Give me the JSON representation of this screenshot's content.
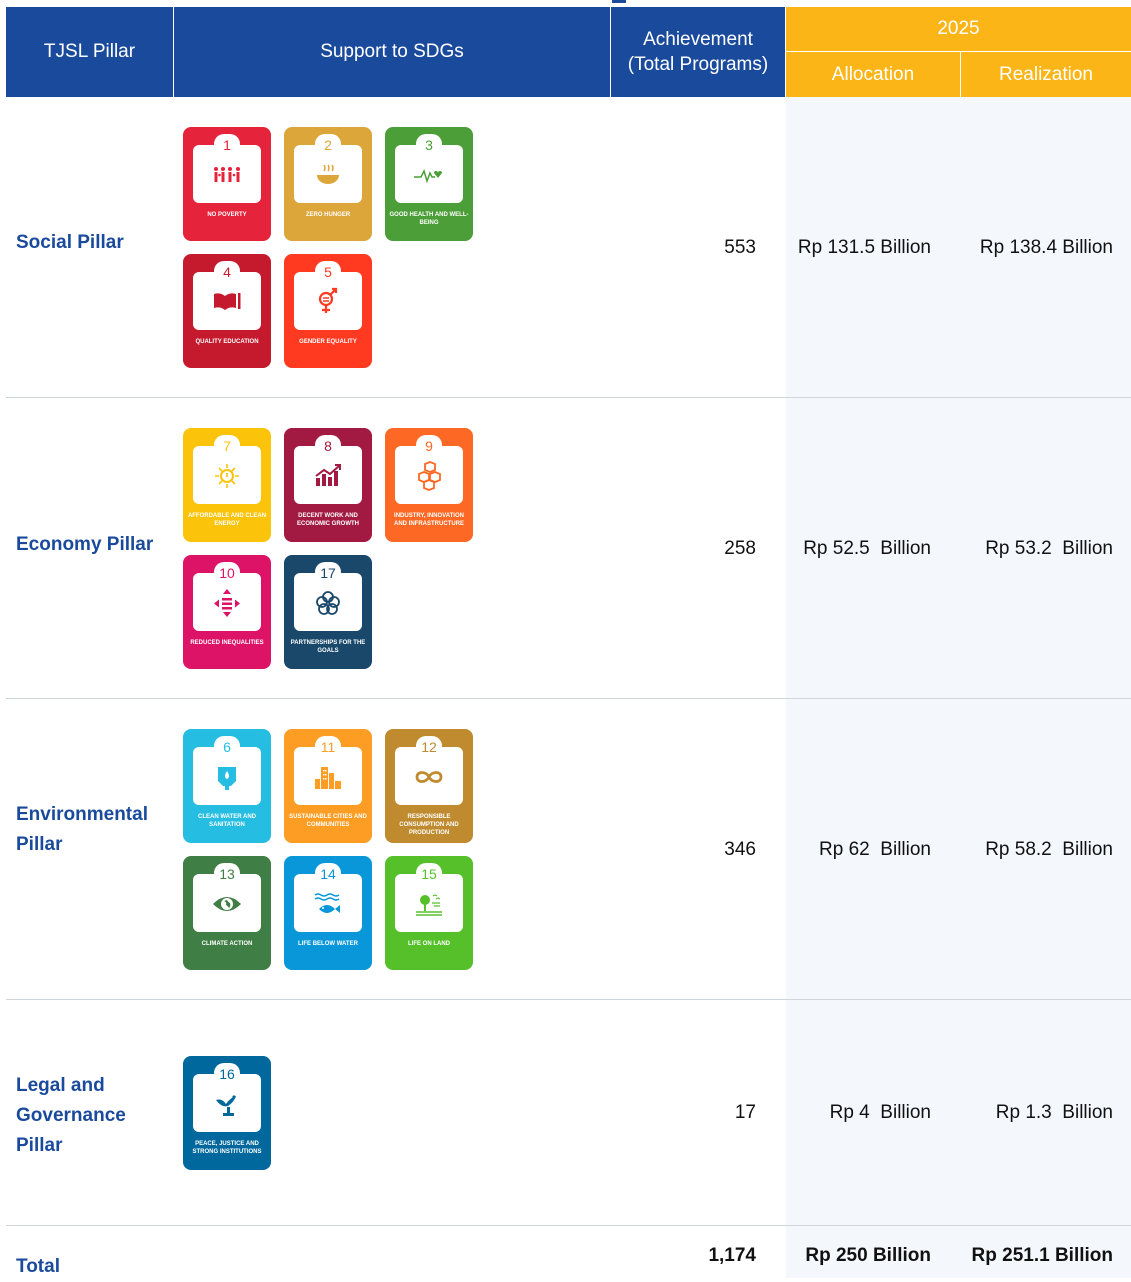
{
  "header": {
    "pillar": "TJSL Pillar",
    "sdgs": "Support to SDGs",
    "achievement": "Achievement (Total Programs)",
    "year": "2025",
    "allocation": "Allocation",
    "realization": "Realization"
  },
  "colors": {
    "header_blue": "#1a4a9c",
    "header_yellow": "#fbb516",
    "pillar_text": "#1a4a9c"
  },
  "rows": [
    {
      "pillar": "Social Pillar",
      "achievement": "553",
      "allocation": "Rp 131.5 Billion",
      "realization": "Rp 138.4 Billion",
      "sdgs": [
        {
          "num": "1",
          "label": "NO POVERTY",
          "color": "#e5243b",
          "icon": "family-icon"
        },
        {
          "num": "2",
          "label": "ZERO HUNGER",
          "color": "#dda63a",
          "icon": "bowl-icon"
        },
        {
          "num": "3",
          "label": "GOOD HEALTH AND WELL-BEING",
          "color": "#4c9f38",
          "icon": "heartbeat-icon"
        },
        {
          "num": "4",
          "label": "QUALITY EDUCATION",
          "color": "#c5192d",
          "icon": "book-icon"
        },
        {
          "num": "5",
          "label": "GENDER EQUALITY",
          "color": "#ff3a21",
          "icon": "gender-icon"
        }
      ]
    },
    {
      "pillar": "Economy Pillar",
      "achievement": "258",
      "allocation": "Rp 52.5  Billion",
      "realization": "Rp 53.2  Billion",
      "sdgs": [
        {
          "num": "7",
          "label": "AFFORDABLE AND CLEAN ENERGY",
          "color": "#fcc30b",
          "icon": "sun-icon"
        },
        {
          "num": "8",
          "label": "DECENT WORK AND ECONOMIC GROWTH",
          "color": "#a21942",
          "icon": "growth-chart-icon"
        },
        {
          "num": "9",
          "label": "INDUSTRY, INNOVATION AND INFRASTRUCTURE",
          "color": "#fd6925",
          "icon": "cubes-icon"
        },
        {
          "num": "10",
          "label": "REDUCED INEQUALITIES",
          "color": "#dd1367",
          "icon": "equality-arrows-icon"
        },
        {
          "num": "17",
          "label": "PARTNERSHIPS FOR THE GOALS",
          "color": "#19486a",
          "icon": "rings-icon"
        }
      ]
    },
    {
      "pillar": "Environmental Pillar",
      "achievement": "346",
      "allocation": "Rp 62  Billion",
      "realization": "Rp 58.2  Billion",
      "sdgs": [
        {
          "num": "6",
          "label": "CLEAN WATER AND SANITATION",
          "color": "#26bde2",
          "icon": "water-drop-icon"
        },
        {
          "num": "11",
          "label": "SUSTAINABLE CITIES AND COMMUNITIES",
          "color": "#fd9d24",
          "icon": "city-icon"
        },
        {
          "num": "12",
          "label": "RESPONSIBLE CONSUMPTION AND PRODUCTION",
          "color": "#bf8b2e",
          "icon": "infinity-icon"
        },
        {
          "num": "13",
          "label": "CLIMATE ACTION",
          "color": "#3f7e44",
          "icon": "eye-globe-icon"
        },
        {
          "num": "14",
          "label": "LIFE BELOW WATER",
          "color": "#0a97d9",
          "icon": "fish-icon"
        },
        {
          "num": "15",
          "label": "LIFE ON LAND",
          "color": "#56c02b",
          "icon": "tree-icon"
        }
      ]
    },
    {
      "pillar": "Legal and Governance Pillar",
      "achievement": "17",
      "allocation": "Rp 4  Billion",
      "realization": "Rp 1.3  Billion",
      "sdgs": [
        {
          "num": "16",
          "label": "PEACE, JUSTICE AND STRONG INSTITUTIONS",
          "color": "#00689d",
          "icon": "dove-gavel-icon"
        }
      ]
    }
  ],
  "total": {
    "label": "Total",
    "achievement": "1,174",
    "allocation": "Rp 250 Billion",
    "realization": "Rp 251.1 Billion"
  }
}
